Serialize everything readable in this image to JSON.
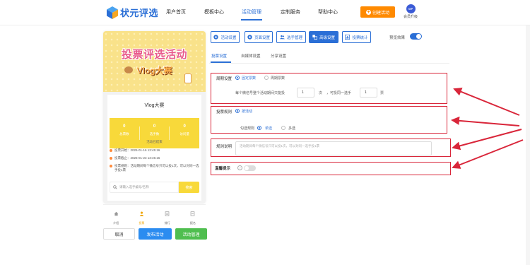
{
  "brand": {
    "logo_text": "状元评选"
  },
  "nav": {
    "items": [
      {
        "label": "用户首页"
      },
      {
        "label": "模板中心"
      },
      {
        "label": "活动管理",
        "active": true
      },
      {
        "label": "定制服务"
      },
      {
        "label": "帮助中心"
      }
    ],
    "create_button": "创建活动",
    "vip_badge": "VIP",
    "vip_label": "会员升级"
  },
  "preview": {
    "banner_title": "投票评选活动",
    "banner_subtitle": "Vlog大赛",
    "event_title": "Vlog大赛",
    "stats": [
      {
        "value": "0",
        "label": "总票数"
      },
      {
        "value": "0",
        "label": "选手数"
      },
      {
        "value": "0",
        "label": "访问量"
      }
    ],
    "status": "活动已结束",
    "info": [
      "投票开始：2025-01-16 13:45:16",
      "投票截止：2025-01-23 13:45:16",
      "投票规则：活动期间每个微信号只可以投1次，可以对同一选手投1票"
    ],
    "search_placeholder": "请输入选手编号/名称",
    "search_button": "搜索",
    "tabbar": [
      {
        "label": "介绍"
      },
      {
        "label": "投票",
        "active": true
      },
      {
        "label": "排行"
      },
      {
        "label": "报名"
      }
    ]
  },
  "actions": {
    "cancel": "取消",
    "publish": "发布活动",
    "manage": "活动管理"
  },
  "toolbar": {
    "buttons": [
      {
        "label": "活动设置"
      },
      {
        "label": "页面设置"
      },
      {
        "label": "选手管理"
      },
      {
        "label": "高级设置",
        "active": true
      },
      {
        "label": "投票统计"
      }
    ],
    "preview_label": "预览效果",
    "preview_on": true
  },
  "subtabs": [
    {
      "label": "投票设置",
      "active": true
    },
    {
      "label": "自媒体设置"
    },
    {
      "label": "分享设置"
    }
  ],
  "settings": {
    "cycle": {
      "label": "周期设置",
      "options": [
        {
          "label": "固定票数",
          "selected": true
        },
        {
          "label": "周期票数",
          "selected": false
        }
      ],
      "sentence_prefix": "每个微信号整个活动期间只能投",
      "votes": "1",
      "unit_times": "次",
      "sentence_middle": "，可投同一选手",
      "per_player": "1",
      "unit_votes": "票"
    },
    "rules": {
      "label": "投票规则",
      "options": [
        {
          "label": "按活动",
          "selected": true
        }
      ],
      "select_label": "勾选规则",
      "select_options": [
        {
          "label": "单选",
          "selected": true
        },
        {
          "label": "多选",
          "selected": false
        }
      ]
    },
    "description": {
      "label": "规则说明",
      "placeholder": "活动期间每个微信号只可以投1次，可以对同一选手投1票"
    },
    "tips": {
      "label": "温馨提示",
      "enabled": false
    }
  },
  "colors": {
    "accent": "#2b6fd6",
    "orange": "#ff8a00",
    "annotation": "#d9263a",
    "yellow": "#f8d93a"
  }
}
